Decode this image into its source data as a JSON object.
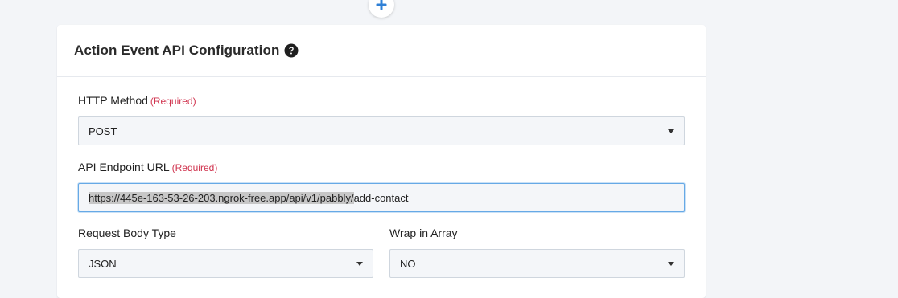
{
  "colors": {
    "accent": "#2f80d6",
    "required": "#d0334e",
    "page_bg": "#f3f5f8",
    "field_bg": "#f4f6f9",
    "focus_border": "#66a9e6"
  },
  "add_step": {
    "icon": "plus-icon"
  },
  "card": {
    "title": "Action Event API Configuration",
    "help_icon": "question-circle-icon"
  },
  "http_method": {
    "label": "HTTP Method",
    "required": "(Required)",
    "value": "POST"
  },
  "endpoint": {
    "label": "API Endpoint URL",
    "required": "(Required)",
    "value_selected": "https://445e-163-53-26-203.ngrok-free.app/api/v1/pabbly/",
    "value_rest": "add-contact"
  },
  "request_body_type": {
    "label": "Request Body Type",
    "value": "JSON"
  },
  "wrap_in_array": {
    "label": "Wrap in Array",
    "value": "NO"
  }
}
